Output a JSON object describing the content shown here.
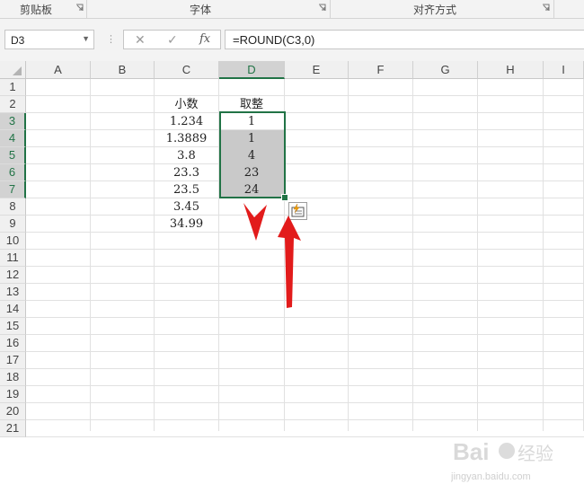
{
  "ribbon": {
    "groups": [
      {
        "label": "剪贴板"
      },
      {
        "label": "字体"
      },
      {
        "label": "对齐方式"
      }
    ]
  },
  "formula_bar": {
    "name_box": "D3",
    "cancel_icon": "✕",
    "enter_icon": "✓",
    "function_label": "fx",
    "formula": "=ROUND(C3,0)"
  },
  "sheet": {
    "columns": [
      "A",
      "B",
      "C",
      "D",
      "E",
      "F",
      "G",
      "H",
      "I"
    ],
    "rows": [
      "1",
      "2",
      "3",
      "4",
      "5",
      "6",
      "7",
      "8",
      "9",
      "10",
      "11",
      "12",
      "13",
      "14",
      "15",
      "16",
      "17",
      "18",
      "19",
      "20",
      "21"
    ],
    "selected_column": "D",
    "selected_rows": [
      "3",
      "4",
      "5",
      "6",
      "7"
    ],
    "headers": {
      "c": "小数",
      "d": "取整"
    },
    "c_values": [
      "1.234",
      "1.3889",
      "3.8",
      "23.3",
      "23.5",
      "3.45",
      "34.99"
    ],
    "d_values": [
      "1",
      "1",
      "4",
      "23",
      "24"
    ]
  },
  "colors": {
    "accent": "#217346",
    "selection_fill": "#c9c9c9",
    "arrow": "#e21b1b"
  },
  "icons": {
    "flash_fill": "flash-fill-icon",
    "cancel": "close-icon",
    "enter": "check-icon",
    "dialog_launcher": "dialog-launcher-icon"
  },
  "watermark": {
    "brand": "Bai",
    "brand_suffix": "经验",
    "url": "jingyan.baidu.com"
  }
}
